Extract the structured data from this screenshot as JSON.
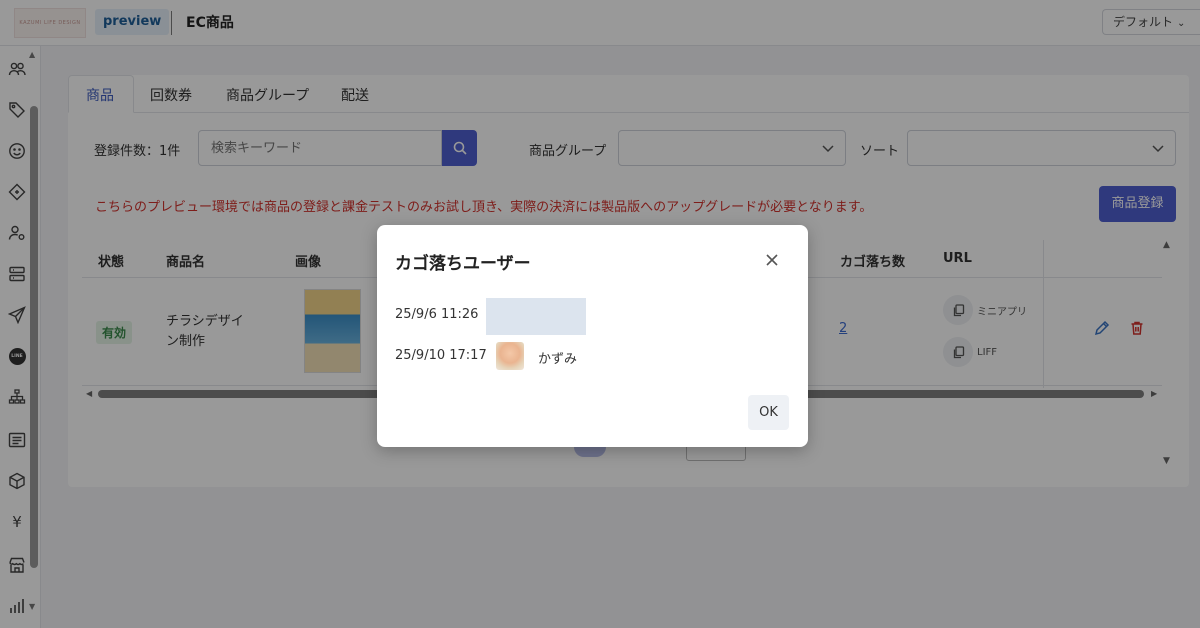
{
  "app": {
    "logo_text": "KAZUMI LIFE DESIGN",
    "preview_badge": "preview",
    "page_title": "EC商品",
    "view_select": "デフォルト",
    "icons": {
      "sidebar": [
        "users-icon",
        "tag-icon",
        "smile-icon",
        "ticket-icon",
        "user-settings-icon",
        "server-icon",
        "send-icon",
        "line-icon",
        "org-chart-icon",
        "message-list-icon",
        "box-icon",
        "yen-icon",
        "store-icon",
        "bar-chart-icon"
      ],
      "line_label": "LINE"
    }
  },
  "tabs": [
    {
      "label": "商品",
      "active": true
    },
    {
      "label": "回数券",
      "active": false
    },
    {
      "label": "商品グループ",
      "active": false
    },
    {
      "label": "配送",
      "active": false
    }
  ],
  "filters": {
    "count_label": "登録件数：1件",
    "search_placeholder": "検索キーワード",
    "group_label": "商品グループ",
    "sort_label": "ソート"
  },
  "notice": "こちらのプレビュー環境では商品の登録と課金テストのみお試し頂き、実際の決済には製品版へのアップグレードが必要となります。",
  "register_button": "商品登録",
  "table": {
    "headers": {
      "status": "状態",
      "name": "商品名",
      "image": "画像",
      "cart_abandon": "カゴ落ち数",
      "url": "URL"
    },
    "rows": [
      {
        "status": "有効",
        "name": "チラシデザイン制作",
        "cart_abandon": "2",
        "url_miniapp": "ミニアプリ",
        "url_liff": "LIFF"
      }
    ]
  },
  "modal": {
    "title": "カゴ落ちユーザー",
    "entries": [
      {
        "time": "25/9/6 11:26",
        "user": ""
      },
      {
        "time": "25/9/10 17:17",
        "user": "かずみ"
      }
    ],
    "ok_label": "OK"
  },
  "colors": {
    "accent": "#4f5fd1",
    "notice_red": "#d2322d",
    "status_green": "#3b8a4c",
    "link_blue": "#3d6bd1"
  }
}
